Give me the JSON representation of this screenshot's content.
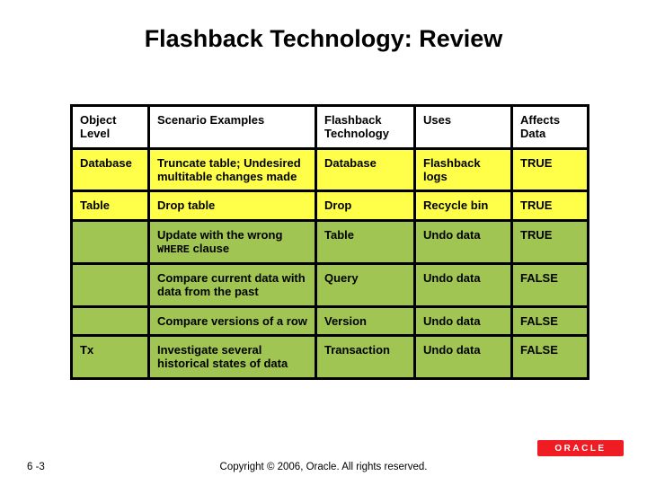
{
  "title": "Flashback Technology: Review",
  "headers": {
    "c1": "Object Level",
    "c2": "Scenario Examples",
    "c3": "Flashback Technology",
    "c4": "Uses",
    "c5": "Affects Data"
  },
  "rows": [
    {
      "class": "yellow",
      "c1": "Database",
      "c2": "Truncate table; Undesired multitable changes made",
      "c3": "Database",
      "c4": "Flashback logs",
      "c5": "TRUE"
    },
    {
      "class": "yellow",
      "c1": "Table",
      "c2": "Drop table",
      "c3": "Drop",
      "c4": "Recycle bin",
      "c5": "TRUE"
    },
    {
      "class": "green",
      "c1": "",
      "c2_pre": "Update with the wrong ",
      "c2_code": "WHERE",
      "c2_post": " clause",
      "c3": "Table",
      "c4": "Undo data",
      "c5": "TRUE"
    },
    {
      "class": "green",
      "c1": "",
      "c2": "Compare current data with data from the past",
      "c3": "Query",
      "c4": "Undo data",
      "c5": "FALSE"
    },
    {
      "class": "green",
      "c1": "",
      "c2": "Compare versions of a row",
      "c3": "Version",
      "c4": "Undo data",
      "c5": "FALSE"
    },
    {
      "class": "green",
      "c1": "Tx",
      "c2": "Investigate several historical states of data",
      "c3": "Transaction",
      "c4": "Undo data",
      "c5": "FALSE"
    }
  ],
  "page_number": "6 -3",
  "copyright": "Copyright © 2006, Oracle. All rights reserved.",
  "logo_text": "ORACLE",
  "chart_data": {
    "type": "table",
    "title": "Flashback Technology: Review",
    "columns": [
      "Object Level",
      "Scenario Examples",
      "Flashback Technology",
      "Uses",
      "Affects Data"
    ],
    "rows": [
      [
        "Database",
        "Truncate table; Undesired multitable changes made",
        "Database",
        "Flashback logs",
        "TRUE"
      ],
      [
        "Table",
        "Drop table",
        "Drop",
        "Recycle bin",
        "TRUE"
      ],
      [
        "",
        "Update with the wrong WHERE clause",
        "Table",
        "Undo data",
        "TRUE"
      ],
      [
        "",
        "Compare current data with data from the past",
        "Query",
        "Undo data",
        "FALSE"
      ],
      [
        "",
        "Compare versions of a row",
        "Version",
        "Undo data",
        "FALSE"
      ],
      [
        "Tx",
        "Investigate several historical states of data",
        "Transaction",
        "Undo data",
        "FALSE"
      ]
    ]
  }
}
